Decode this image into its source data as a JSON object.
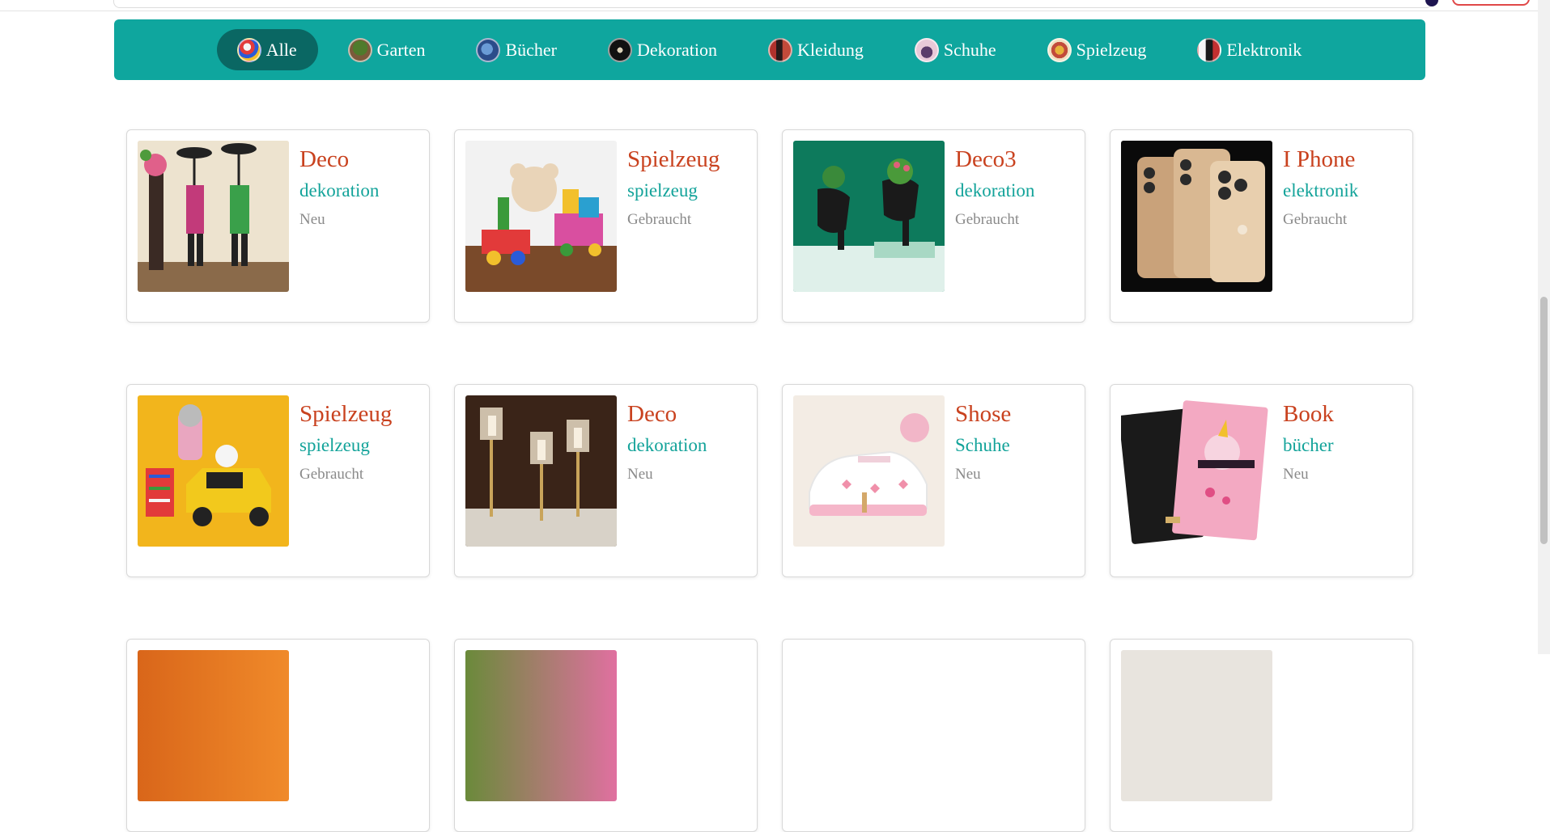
{
  "categories": [
    {
      "label": "Alle",
      "active": true,
      "icon": "all-categories-icon"
    },
    {
      "label": "Garten",
      "active": false,
      "icon": "garden-thumb-icon"
    },
    {
      "label": "Bücher",
      "active": false,
      "icon": "books-thumb-icon"
    },
    {
      "label": "Dekoration",
      "active": false,
      "icon": "decoration-thumb-icon"
    },
    {
      "label": "Kleidung",
      "active": false,
      "icon": "clothing-thumb-icon"
    },
    {
      "label": "Schuhe",
      "active": false,
      "icon": "shoes-thumb-icon"
    },
    {
      "label": "Spielzeug",
      "active": false,
      "icon": "toys-thumb-icon"
    },
    {
      "label": "Elektronik",
      "active": false,
      "icon": "electronics-thumb-icon"
    }
  ],
  "products": [
    {
      "title": "Deco",
      "category": "dekoration",
      "condition": "Neu"
    },
    {
      "title": "Spielzeug",
      "category": "spielzeug",
      "condition": "Gebraucht"
    },
    {
      "title": "Deco3",
      "category": "dekoration",
      "condition": "Gebraucht"
    },
    {
      "title": "I Phone",
      "category": "elektronik",
      "condition": "Gebraucht"
    },
    {
      "title": "Spielzeug",
      "category": "spielzeug",
      "condition": "Gebraucht"
    },
    {
      "title": "Deco",
      "category": "dekoration",
      "condition": "Neu"
    },
    {
      "title": "Shose",
      "category": "Schuhe",
      "condition": "Neu"
    },
    {
      "title": "Book",
      "category": "bücher",
      "condition": "Neu"
    }
  ],
  "colors": {
    "category_bar": "#0fa69e",
    "active_category": "#0a6763",
    "title": "#c9421f",
    "category_text": "#13a39a",
    "condition_text": "#8a8a8a"
  }
}
